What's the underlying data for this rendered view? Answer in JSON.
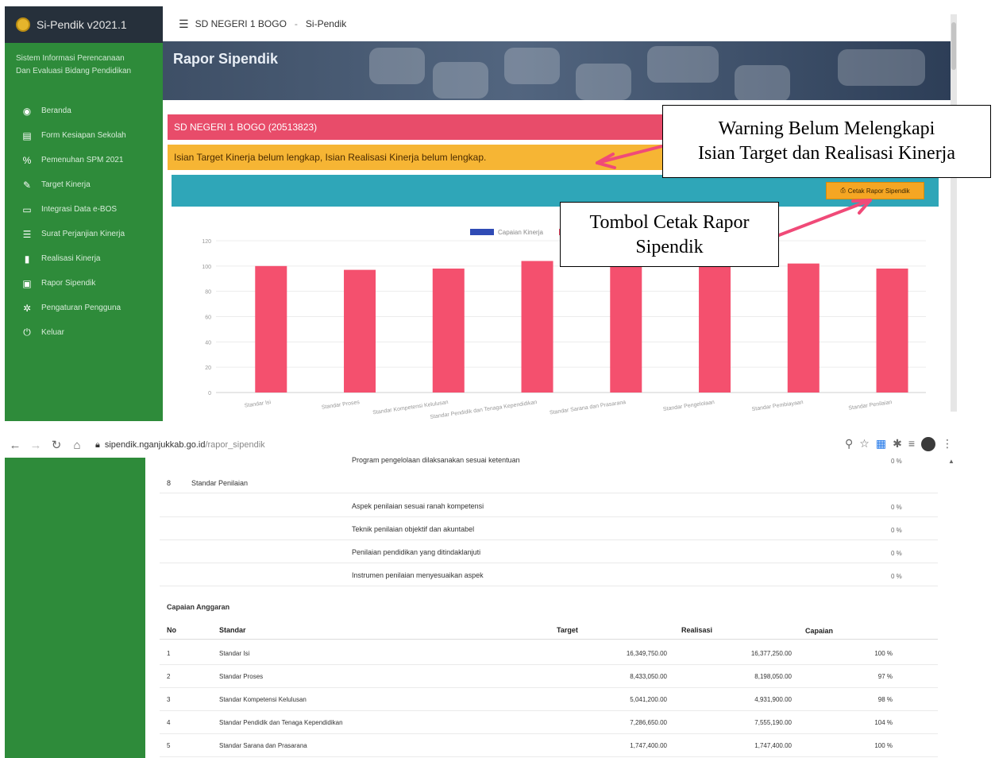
{
  "app": {
    "name": "Si-Pendik v2021.1",
    "tagline_line1": "Sistem Informasi Perencanaan",
    "tagline_line2": "Dan Evaluasi Bidang Pendidikan"
  },
  "sidebar": {
    "items": [
      {
        "label": "Beranda",
        "icon": "dashboard-icon",
        "glyph": "◉"
      },
      {
        "label": "Form Kesiapan Sekolah",
        "icon": "file-icon",
        "glyph": "▤"
      },
      {
        "label": "Pemenuhan SPM 2021",
        "icon": "percent-icon",
        "glyph": "%"
      },
      {
        "label": "Target Kinerja",
        "icon": "edit-icon",
        "glyph": "✎"
      },
      {
        "label": "Integrasi Data e-BOS",
        "icon": "monitor-icon",
        "glyph": "▭"
      },
      {
        "label": "Surat Perjanjian Kinerja",
        "icon": "list-icon",
        "glyph": "☰"
      },
      {
        "label": "Realisasi Kinerja",
        "icon": "document-icon",
        "glyph": "▮"
      },
      {
        "label": "Rapor Sipendik",
        "icon": "save-icon",
        "glyph": "▣"
      },
      {
        "label": "Pengaturan Pengguna",
        "icon": "cogs-icon",
        "glyph": "✲"
      },
      {
        "label": "Keluar",
        "icon": "power-icon",
        "glyph": "⏻"
      }
    ]
  },
  "topbar": {
    "school": "SD NEGERI 1 BOGO",
    "separator": "-",
    "app": "Si-Pendik"
  },
  "banner": {
    "title": "Rapor Sipendik"
  },
  "school_bar": "SD NEGERI 1 BOGO (20513823)",
  "warning_text": "Isian Target Kinerja belum lengkap, Isian Realisasi Kinerja belum lengkap.",
  "print_button": "Cetak Rapor Sipendik",
  "annotations": {
    "warning_line1": "Warning Belum Melengkapi",
    "warning_line2": "Isian Target dan Realisasi Kinerja",
    "print_line1": "Tombol Cetak Rapor",
    "print_line2": "Sipendik",
    "arrow_color": "#f04a78"
  },
  "chart_data": {
    "type": "bar",
    "legend": [
      "Capaian Kinerja"
    ],
    "legend_colors": [
      "#2f4bb5",
      "#f4506e"
    ],
    "categories": [
      "Standar Isi",
      "Standar Proses",
      "Standar Kompetensi Kelulusan",
      "Standar Pendidik dan Tenaga Kependidikan",
      "Standar Sarana dan Prasarana",
      "Standar Pengelolaan",
      "Standar Pembiayaan",
      "Standar Penilaian"
    ],
    "series": [
      {
        "name": "Capaian Kinerja",
        "values": [
          100,
          97,
          98,
          104,
          100,
          100,
          102,
          98
        ],
        "color": "#f4506e"
      }
    ],
    "ylim": [
      0,
      120
    ],
    "yticks": [
      0,
      20,
      40,
      60,
      80,
      100,
      120
    ],
    "grid": true
  },
  "browser": {
    "url_host": "sipendik.nganjukkab.go.id",
    "url_path": "/rapor_sipendik"
  },
  "penilaian": {
    "prev_indicator": "Program pengelolaan dilaksanakan sesuai ketentuan",
    "prev_pct": "0 %",
    "no": "8",
    "standard": "Standar Penilaian",
    "indicators": [
      {
        "text": "Aspek penilaian sesuai ranah kompetensi",
        "pct": "0 %"
      },
      {
        "text": "Teknik penilaian objektif dan akuntabel",
        "pct": "0 %"
      },
      {
        "text": "Penilaian pendidikan yang ditindaklanjuti",
        "pct": "0 %"
      },
      {
        "text": "Instrumen penilaian menyesuaikan aspek",
        "pct": "0 %"
      }
    ]
  },
  "budget": {
    "title": "Capaian Anggaran",
    "headers": {
      "no": "No",
      "standar": "Standar",
      "target": "Target",
      "realisasi": "Realisasi",
      "capaian": "Capaian"
    },
    "rows": [
      {
        "no": "1",
        "standar": "Standar Isi",
        "target": "16,349,750.00",
        "realisasi": "16,377,250.00",
        "capaian": "100 %"
      },
      {
        "no": "2",
        "standar": "Standar Proses",
        "target": "8,433,050.00",
        "realisasi": "8,198,050.00",
        "capaian": "97 %"
      },
      {
        "no": "3",
        "standar": "Standar Kompetensi Kelulusan",
        "target": "5,041,200.00",
        "realisasi": "4,931,900.00",
        "capaian": "98 %"
      },
      {
        "no": "4",
        "standar": "Standar Pendidik dan Tenaga Kependidikan",
        "target": "7,286,650.00",
        "realisasi": "7,555,190.00",
        "capaian": "104 %"
      },
      {
        "no": "5",
        "standar": "Standar Sarana dan Prasarana",
        "target": "1,747,400.00",
        "realisasi": "1,747,400.00",
        "capaian": "100 %"
      }
    ]
  }
}
